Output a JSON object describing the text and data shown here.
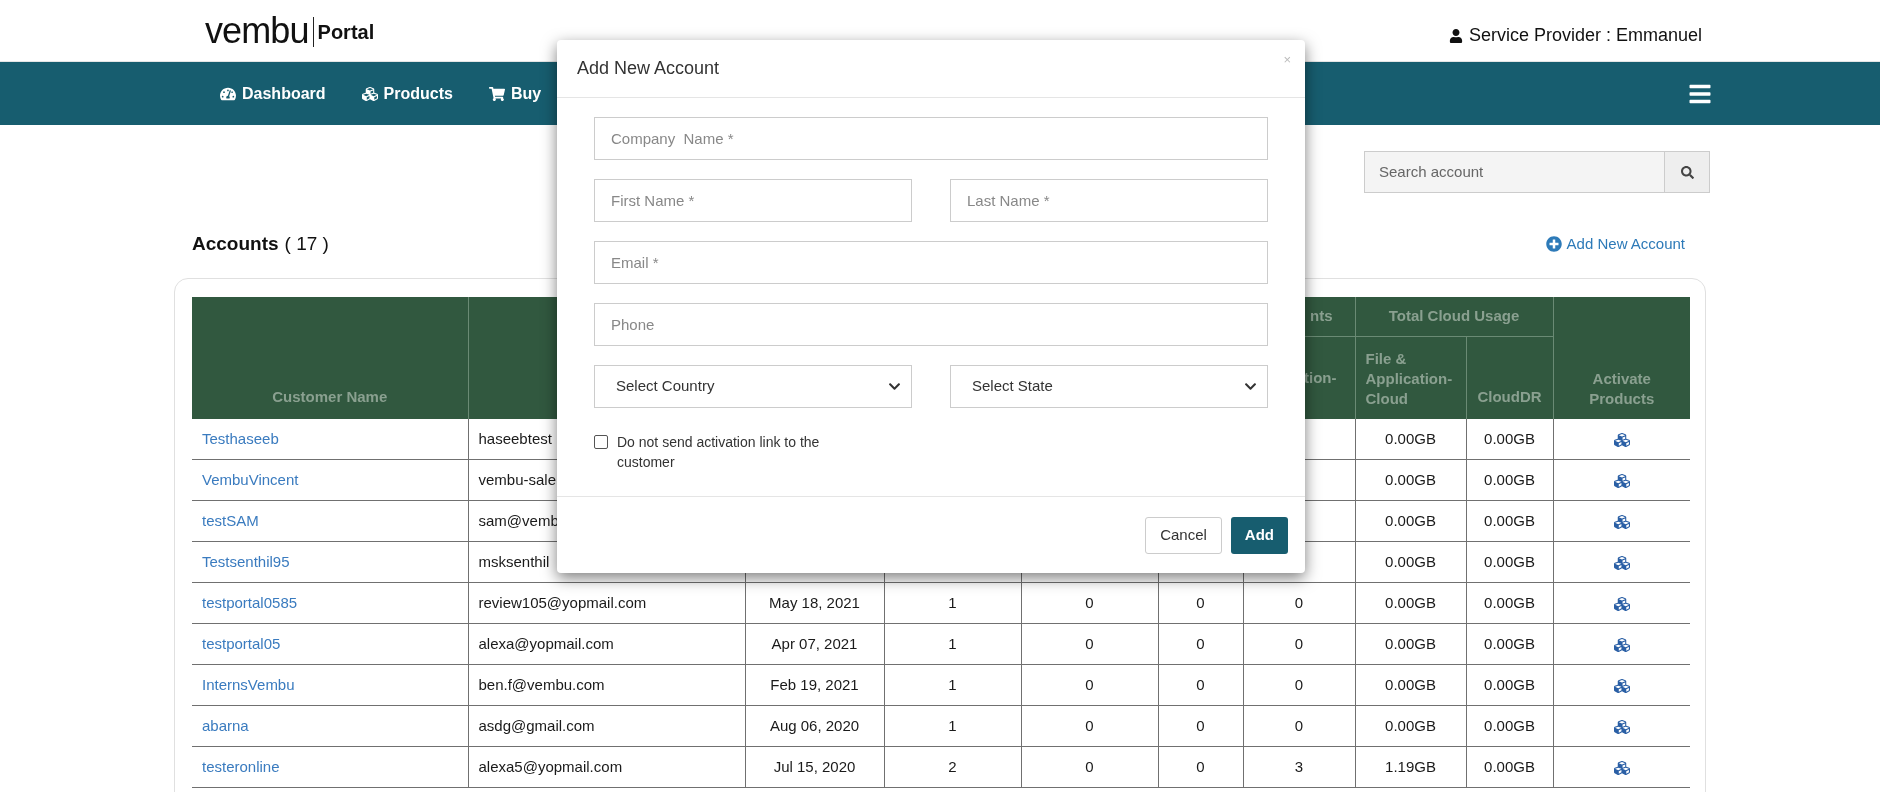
{
  "header": {
    "logo": "vembu",
    "logo_suffix": "Portal",
    "user": "Service Provider : Emmanuel"
  },
  "nav": {
    "items": [
      {
        "label": "Dashboard",
        "kind": "dashboard"
      },
      {
        "label": "Products",
        "kind": "cubes"
      },
      {
        "label": "Buy",
        "kind": "cart"
      }
    ]
  },
  "search": {
    "placeholder": "Search account"
  },
  "accounts": {
    "title": "Accounts",
    "count": "( 17 )",
    "add_link": "Add New Account"
  },
  "table": {
    "header_top": {
      "customer": "Customer Name",
      "group_fragment": "nts",
      "cloud_group": "Total Cloud Usage",
      "activate": "Activate Products"
    },
    "header_sub": {
      "col_7_fragment": "tion-",
      "file_app": "File & Application-Cloud",
      "cloud_dr": "CloudDR"
    },
    "rows": [
      {
        "name": "Testhaseeb",
        "email": "haseebtest",
        "cells": [],
        "file_app": "0.00GB",
        "cloud_dr": "0.00GB"
      },
      {
        "name": "VembuVincent",
        "email": "vembu-sale",
        "cells": [],
        "file_app": "0.00GB",
        "cloud_dr": "0.00GB"
      },
      {
        "name": "testSAM",
        "email": "sam@vemb",
        "cells": [],
        "file_app": "0.00GB",
        "cloud_dr": "0.00GB"
      },
      {
        "name": "Testsenthil95",
        "email": "msksenthil",
        "cells": [],
        "file_app": "0.00GB",
        "cloud_dr": "0.00GB"
      },
      {
        "name": "testportal0585",
        "email": "review105@yopmail.com",
        "cells": [
          "May 18, 2021",
          "1",
          "0",
          "0",
          "0"
        ],
        "file_app": "0.00GB",
        "cloud_dr": "0.00GB"
      },
      {
        "name": "testportal05",
        "email": "alexa@yopmail.com",
        "cells": [
          "Apr 07, 2021",
          "1",
          "0",
          "0",
          "0"
        ],
        "file_app": "0.00GB",
        "cloud_dr": "0.00GB"
      },
      {
        "name": "InternsVembu",
        "email": "ben.f@vembu.com",
        "cells": [
          "Feb 19, 2021",
          "1",
          "0",
          "0",
          "0"
        ],
        "file_app": "0.00GB",
        "cloud_dr": "0.00GB"
      },
      {
        "name": "abarna",
        "email": "asdg@gmail.com",
        "cells": [
          "Aug 06, 2020",
          "1",
          "0",
          "0",
          "0"
        ],
        "file_app": "0.00GB",
        "cloud_dr": "0.00GB"
      },
      {
        "name": "testeronline",
        "email": "alexa5@yopmail.com",
        "cells": [
          "Jul 15, 2020",
          "2",
          "0",
          "0",
          "3"
        ],
        "file_app": "1.19GB",
        "cloud_dr": "0.00GB"
      }
    ]
  },
  "modal": {
    "title": "Add New Account",
    "close": "×",
    "fields": [
      {
        "kind": "text",
        "placeholder": "Company  Name *"
      },
      {
        "kind": "pair",
        "items": [
          {
            "kind": "text",
            "placeholder": "First Name *"
          },
          {
            "kind": "text",
            "placeholder": "Last Name *"
          }
        ]
      },
      {
        "kind": "text",
        "placeholder": "Email *"
      },
      {
        "kind": "text",
        "placeholder": "Phone"
      },
      {
        "kind": "pair",
        "items": [
          {
            "kind": "select",
            "value": "Select Country"
          },
          {
            "kind": "select",
            "value": "Select State"
          }
        ]
      }
    ],
    "checkbox": {
      "label": "Do not send activation link to the customer",
      "checked": false
    },
    "buttons": [
      {
        "kind": "secondary",
        "label": "Cancel"
      },
      {
        "kind": "primary",
        "label": "Add"
      }
    ]
  }
}
